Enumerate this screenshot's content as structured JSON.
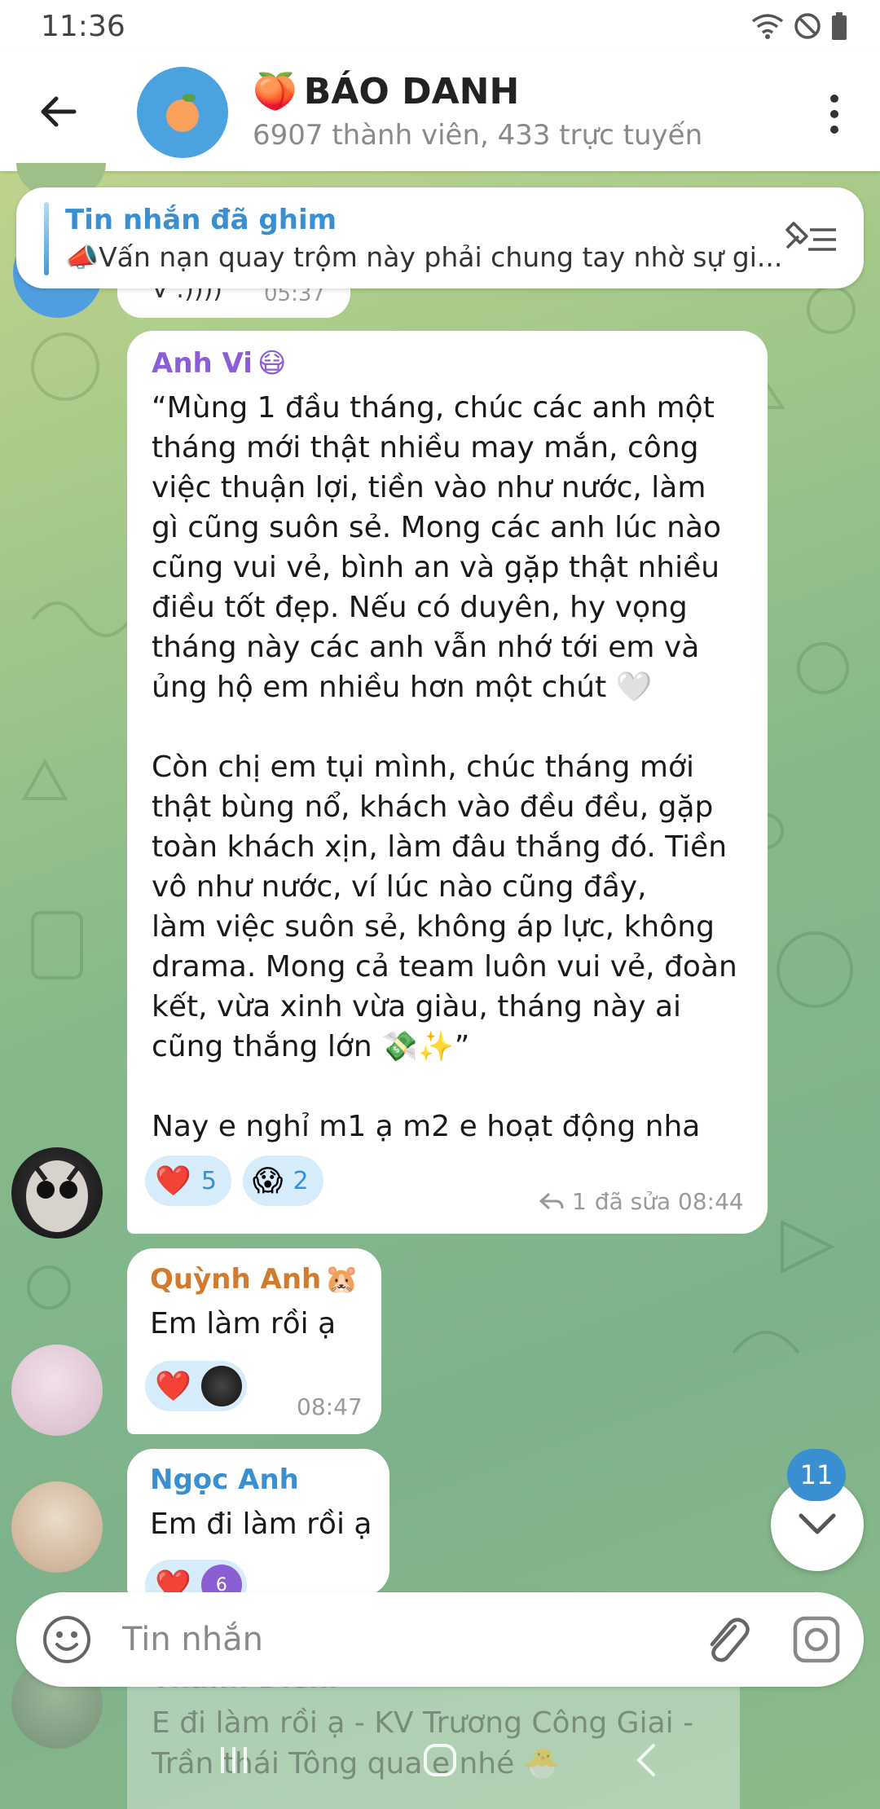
{
  "status_bar": {
    "time": "11:36"
  },
  "header": {
    "title": "BÁO DANH",
    "title_emoji": "🍑",
    "subtitle": "6907 thành viên, 433 trực tuyến"
  },
  "pinned": {
    "title": "Tin nhắn đã ghim",
    "emoji": "📣",
    "text": "Vấn nạn quay trộm này phải chung tay nhờ sự gi..."
  },
  "previous_message": {
    "text": "V :))))",
    "time": "05:37"
  },
  "messages": [
    {
      "sender": "Anh Vi",
      "sender_emoji": "😷",
      "text": "“Mùng 1 đầu tháng, chúc các anh một\ntháng mới thật nhiều may mắn, công\nviệc thuận lợi, tiền vào như nước, làm\ngì cũng suôn sẻ. Mong các anh lúc nào\ncũng vui vẻ, bình an và gặp thật nhiều\nđiều tốt đẹp. Nếu có duyên, hy vọng\ntháng này các anh vẫn nhớ tới em và\nủng hộ em nhiều hơn một chút 🤍\n\nCòn chị em tụi mình, chúc tháng mới\nthật bùng nổ, khách vào đều đều, gặp\ntoàn khách xịn, làm đâu thắng đó. Tiền\nvô như nước, ví lúc nào cũng đầy,\nlàm việc suôn sẻ, không áp lực, không\ndrama. Mong cả team luôn vui vẻ, đoàn\nkết, vừa xinh vừa giàu, tháng này ai\ncũng thắng lớn 💸✨”\n\nNay e nghỉ m1 ạ m2 e hoạt động nha",
      "reactions": [
        {
          "emoji": "❤️",
          "count": "5"
        },
        {
          "emoji": "😱",
          "count": "2"
        }
      ],
      "replies": "1",
      "edited_time": "đã sửa 08:44"
    },
    {
      "sender": "Quỳnh Anh",
      "sender_emoji": "🐹",
      "text": "Em làm rồi ạ",
      "reactions": [
        {
          "emoji": "❤️"
        }
      ],
      "time": "08:47"
    },
    {
      "sender": "Ngọc Anh",
      "text": "Em đi làm rồi ạ",
      "reactions": [
        {
          "emoji": "❤️",
          "count": "6"
        }
      ]
    }
  ],
  "ghost_message": {
    "sender": "Thanh Diễm",
    "text": "E đi làm rồi ạ - KV Trương Công Giai - Trần thái Tông qua e nhé 🐣"
  },
  "scroll_badge": "11",
  "input": {
    "placeholder": "Tin nhắn"
  },
  "colors": {
    "accent": "#3a8fd0",
    "sender_anh_vi": "#8b5fd4",
    "sender_quynh_anh": "#d27a2d",
    "sender_ngoc_anh": "#3a8fd0"
  }
}
